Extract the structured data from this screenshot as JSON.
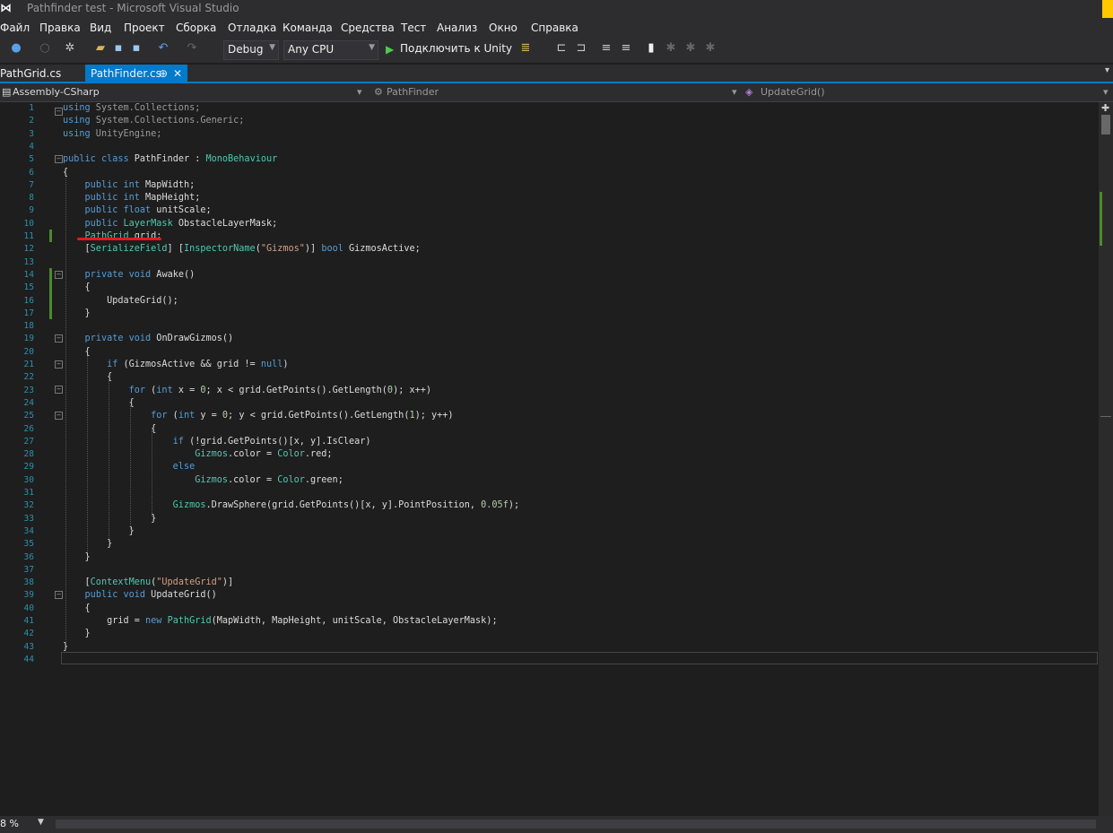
{
  "window": {
    "title": "Pathfinder test - Microsoft Visual Studio"
  },
  "menu": [
    "Файл",
    "Правка",
    "Вид",
    "Проект",
    "Сборка",
    "Отладка",
    "Команда",
    "Средства",
    "Тест",
    "Анализ",
    "Окно",
    "Справка"
  ],
  "toolbar": {
    "config": "Debug",
    "platform": "Any CPU",
    "attach_label": "Подключить к Unity"
  },
  "tabs": [
    {
      "label": "PathGrid.cs",
      "active": false
    },
    {
      "label": "PathFinder.cs",
      "active": true
    }
  ],
  "navbar": {
    "project": "Assembly-CSharp",
    "class": "PathFinder",
    "member": "UpdateGrid()"
  },
  "code": {
    "line_numbers": [
      "1",
      "2",
      "3",
      "4",
      "5",
      "6",
      "7",
      "8",
      "9",
      "10",
      "11",
      "12",
      "13",
      "14",
      "15",
      "16",
      "17",
      "18",
      "19",
      "20",
      "21",
      "22",
      "23",
      "24",
      "25",
      "26",
      "27",
      "28",
      "29",
      "30",
      "31",
      "32",
      "33",
      "34",
      "35",
      "36",
      "37",
      "38",
      "39",
      "40",
      "41",
      "42",
      "43",
      "44"
    ],
    "lines": [
      "using System.Collections;",
      "using System.Collections.Generic;",
      "using UnityEngine;",
      "",
      "public class PathFinder : MonoBehaviour",
      "{",
      "    public int MapWidth;",
      "    public int MapHeight;",
      "    public float unitScale;",
      "    public LayerMask ObstacleLayerMask;",
      "    PathGrid grid;",
      "    [SerializeField] [InspectorName(\"Gizmos\")] bool GizmosActive;",
      "",
      "    private void Awake()",
      "    {",
      "        UpdateGrid();",
      "    }",
      "",
      "    private void OnDrawGizmos()",
      "    {",
      "        if (GizmosActive && grid != null)",
      "        {",
      "            for (int x = 0; x < grid.GetPoints().GetLength(0); x++)",
      "            {",
      "                for (int y = 0; y < grid.GetPoints().GetLength(1); y++)",
      "                {",
      "                    if (!grid.GetPoints()[x, y].IsClear)",
      "                        Gizmos.color = Color.red;",
      "                    else",
      "                        Gizmos.color = Color.green;",
      "",
      "                    Gizmos.DrawSphere(grid.GetPoints()[x, y].PointPosition, 0.05f);",
      "                }",
      "            }",
      "        }",
      "    }",
      "",
      "    [ContextMenu(\"UpdateGrid\")]",
      "    public void UpdateGrid()",
      "    {",
      "        grid = new PathGrid(MapWidth, MapHeight, unitScale, ObstacleLayerMask);",
      "    }",
      "}",
      ""
    ]
  },
  "status": {
    "zoom": "8 %"
  }
}
